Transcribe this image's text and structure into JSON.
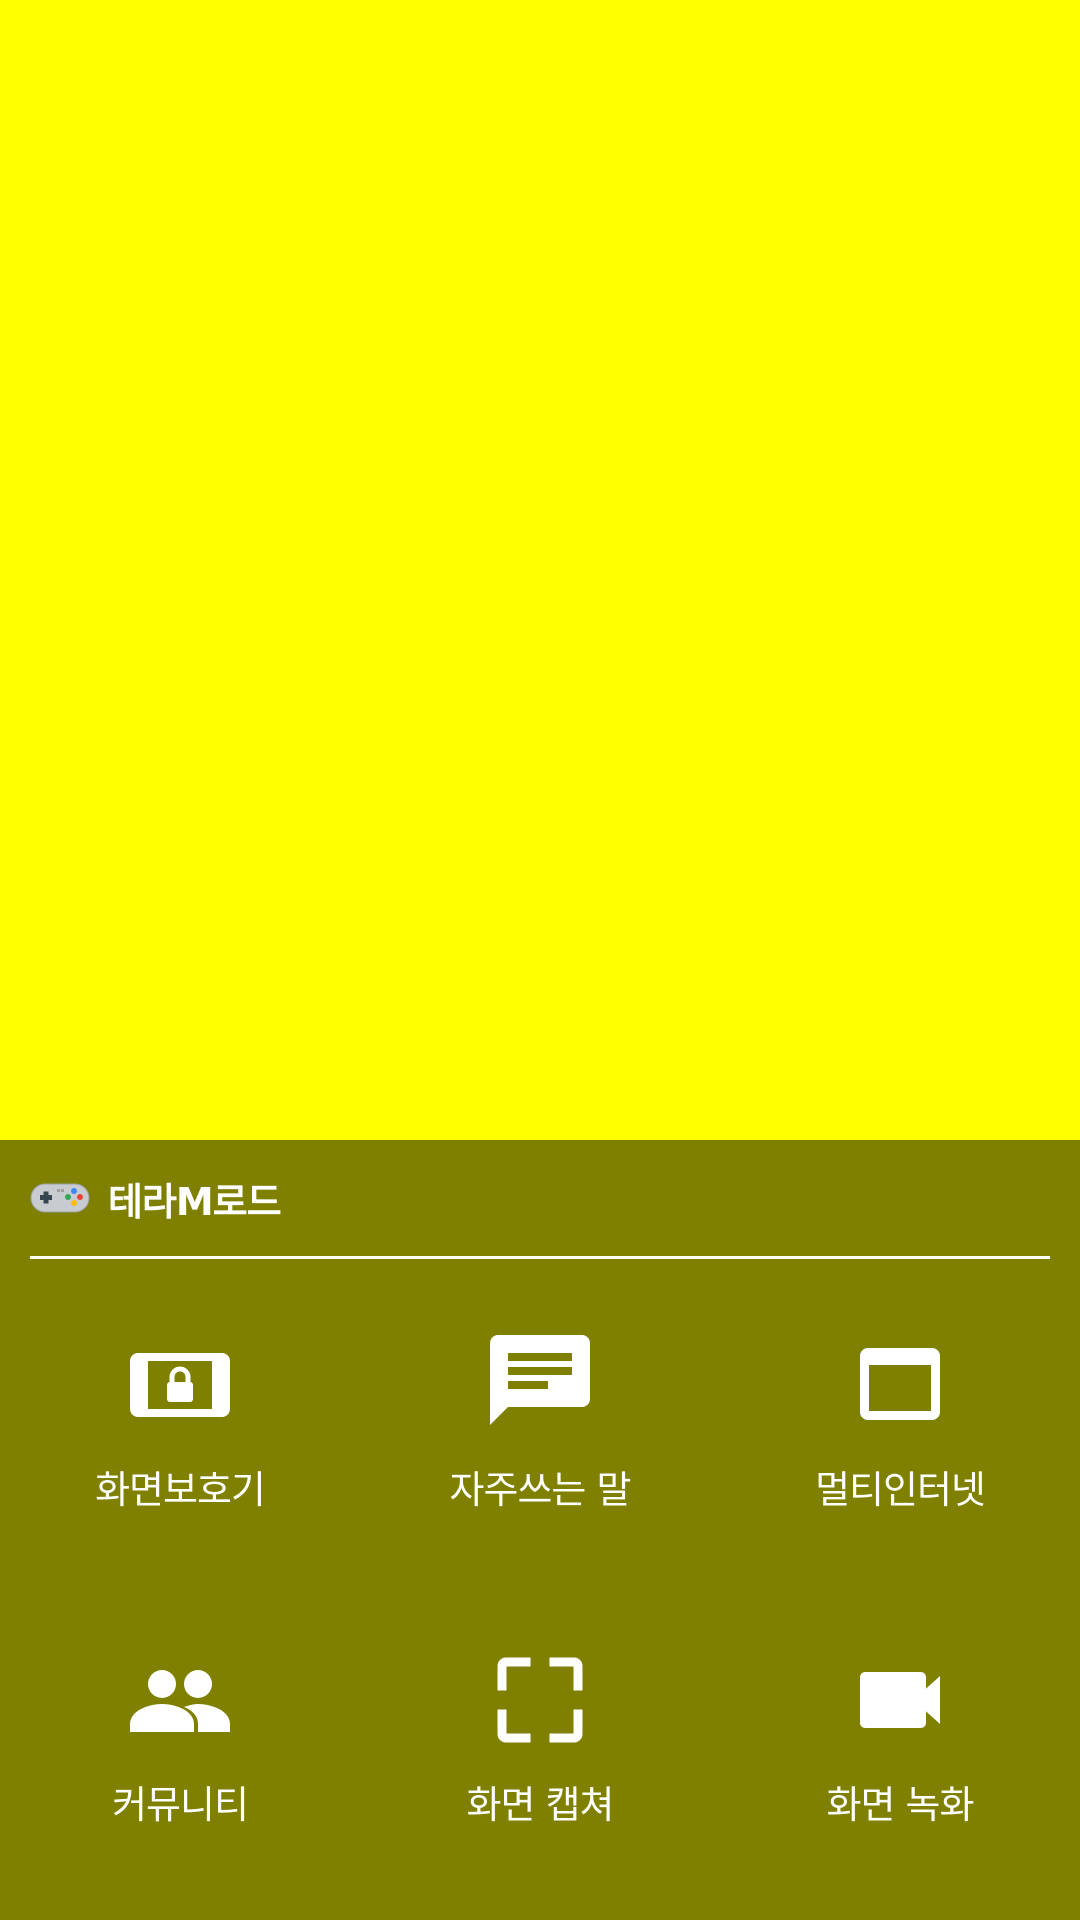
{
  "header": {
    "title": "테라M로드",
    "icon": "gamepad-icon"
  },
  "colors": {
    "background": "#ffff00",
    "panel": "#7f7f00",
    "foreground": "#ffffff"
  },
  "menu": {
    "items": [
      {
        "label": "화면보호기",
        "icon": "screen-lock-icon"
      },
      {
        "label": "자주쓰는 말",
        "icon": "message-icon"
      },
      {
        "label": "멀티인터넷",
        "icon": "window-icon"
      },
      {
        "label": "커뮤니티",
        "icon": "people-icon"
      },
      {
        "label": "화면 캡쳐",
        "icon": "capture-frame-icon"
      },
      {
        "label": "화면 녹화",
        "icon": "video-camera-icon"
      }
    ]
  }
}
